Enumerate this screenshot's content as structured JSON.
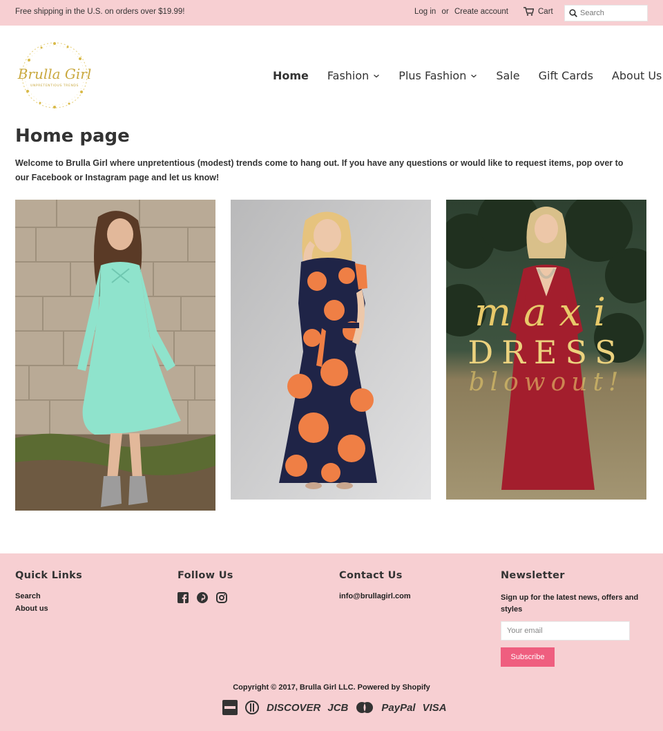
{
  "topbar": {
    "shipping": "Free shipping in the U.S. on orders over $19.99!",
    "login": "Log in",
    "or": "or",
    "create_account": "Create account",
    "cart": "Cart",
    "search_placeholder": "Search"
  },
  "logo": {
    "text": "Brulla Girl",
    "subtext": "UNPRETENTIOUS TRENDS"
  },
  "nav": {
    "items": [
      {
        "label": "Home",
        "dropdown": false
      },
      {
        "label": "Fashion",
        "dropdown": true
      },
      {
        "label": "Plus Fashion",
        "dropdown": true
      },
      {
        "label": "Sale",
        "dropdown": false
      },
      {
        "label": "Gift Cards",
        "dropdown": false
      },
      {
        "label": "About Us",
        "dropdown": false
      }
    ]
  },
  "main": {
    "title": "Home page",
    "intro": "Welcome to Brulla Girl where unpretentious (modest) trends come to hang out. If you have any questions or would like to request items, pop over to our Facebook or Instagram page and let us know!",
    "promo": {
      "line1": "maxi",
      "line2": "DRESS",
      "line3": "blowout!"
    }
  },
  "footer": {
    "quick_links": {
      "heading": "Quick Links",
      "links": [
        "Search",
        "About us"
      ]
    },
    "follow": {
      "heading": "Follow Us",
      "icons": [
        "facebook-icon",
        "pinterest-icon",
        "instagram-icon"
      ]
    },
    "contact": {
      "heading": "Contact Us",
      "email": "info@brullagirl.com"
    },
    "newsletter": {
      "heading": "Newsletter",
      "text": "Sign up for the latest news, offers and styles",
      "placeholder": "Your email",
      "button": "Subscribe"
    },
    "copyright": "Copyright © 2017, Brulla Girl LLC. Powered by Shopify",
    "payments": [
      "american-express",
      "diners-club",
      "DISCOVER",
      "JCB",
      "master",
      "PayPal",
      "VISA"
    ]
  },
  "colors": {
    "pink": "#f7cfd2",
    "button": "#ef5e7f",
    "text": "#333333"
  }
}
